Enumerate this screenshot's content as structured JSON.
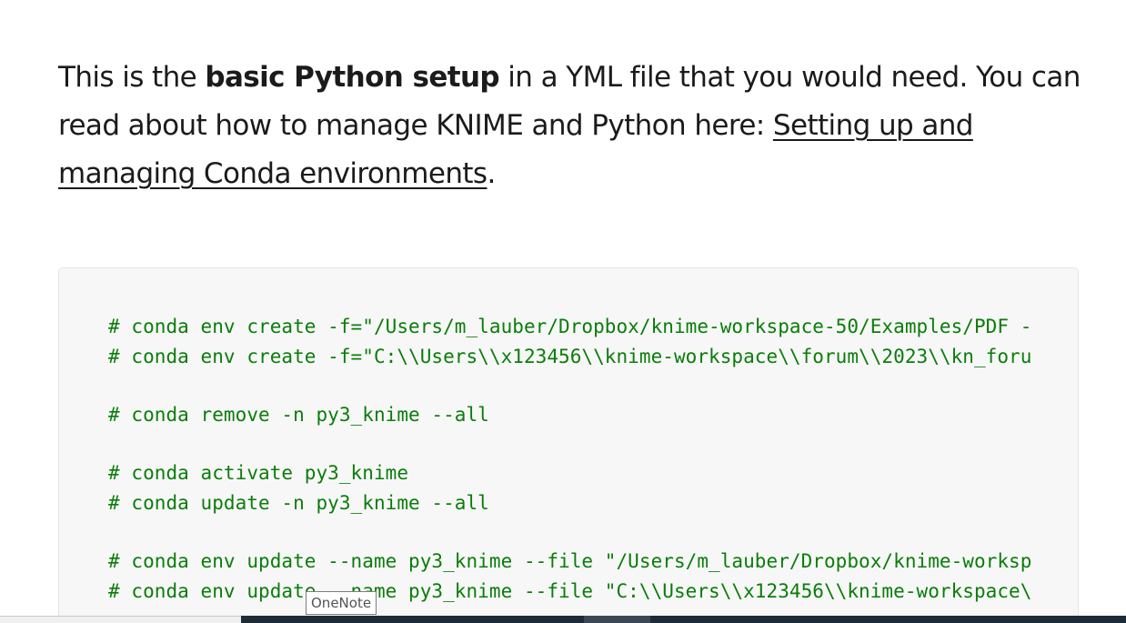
{
  "paragraph": {
    "text_before": "This is the ",
    "bold_text": "basic Python setup",
    "text_middle": " in a YML file that you would need. You can read about how to manage KNIME and Python here: ",
    "link_text": "Setting up and managing Conda environments",
    "text_after": "."
  },
  "code_lines": [
    "# conda env create -f=\"/Users/m_lauber/Dropbox/knime-workspace-50/Examples/PDF -",
    "# conda env create -f=\"C:\\\\Users\\\\x123456\\\\knime-workspace\\\\forum\\\\2023\\\\kn_foru",
    "# conda remove -n py3_knime --all",
    "# conda activate py3_knime",
    "# conda update -n py3_knime --all",
    "# conda env update --name py3_knime --file \"/Users/m_lauber/Dropbox/knime-worksp",
    "# conda env update --name py3_knime --file \"C:\\\\Users\\\\x123456\\\\knime-workspace\\"
  ],
  "tooltip": {
    "label": "OneNote"
  },
  "colors": {
    "text": "#1b1b1b",
    "code_comment": "#0a7d0a",
    "code_background": "#f7f7f7",
    "taskbar": "#1d2b36"
  }
}
